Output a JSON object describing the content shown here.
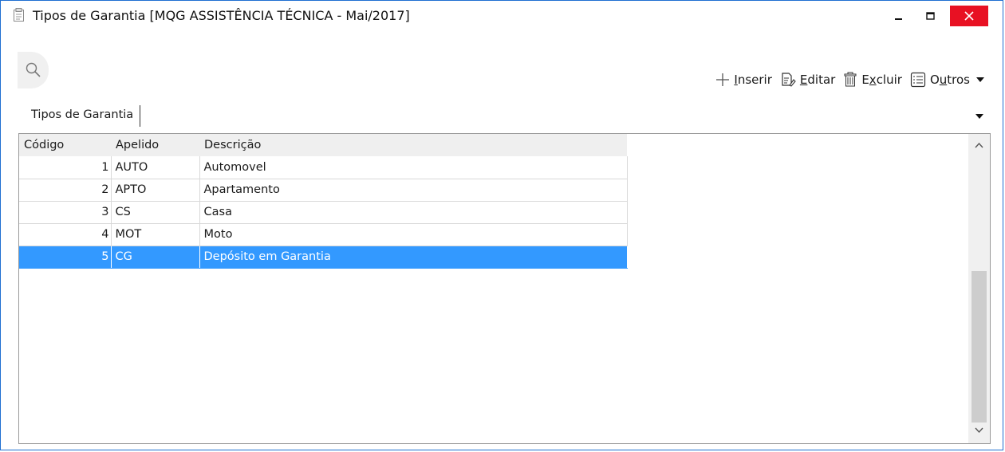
{
  "window": {
    "title": "Tipos de Garantia [MQG ASSISTÊNCIA TÉCNICA - Mai/2017]",
    "accent_color": "#1f6fd1",
    "close_color": "#e81123"
  },
  "toolbar": {
    "insert": {
      "key": "I",
      "rest": "nserir",
      "icon": "plus-icon"
    },
    "edit": {
      "key": "E",
      "rest": "ditar",
      "icon": "edit-document-icon"
    },
    "delete_pre": "E",
    "delete": {
      "key": "x",
      "rest": "cluir",
      "icon": "trash-icon"
    },
    "other_pre": "O",
    "other": {
      "key": "u",
      "rest": "tros",
      "icon": "list-icon"
    }
  },
  "tabs": [
    {
      "label": "Tipos de Garantia",
      "active": true
    }
  ],
  "grid": {
    "columns": [
      "Código",
      "Apelido",
      "Descrição"
    ],
    "rows": [
      {
        "codigo": "1",
        "apelido": "AUTO",
        "descricao": "Automovel",
        "selected": false
      },
      {
        "codigo": "2",
        "apelido": "APTO",
        "descricao": "Apartamento",
        "selected": false
      },
      {
        "codigo": "3",
        "apelido": "CS",
        "descricao": "Casa",
        "selected": false
      },
      {
        "codigo": "4",
        "apelido": "MOT",
        "descricao": "Moto",
        "selected": false
      },
      {
        "codigo": "5",
        "apelido": "CG",
        "descricao": "Depósito em Garantia",
        "selected": true
      }
    ],
    "selection_color": "#3399ff"
  }
}
